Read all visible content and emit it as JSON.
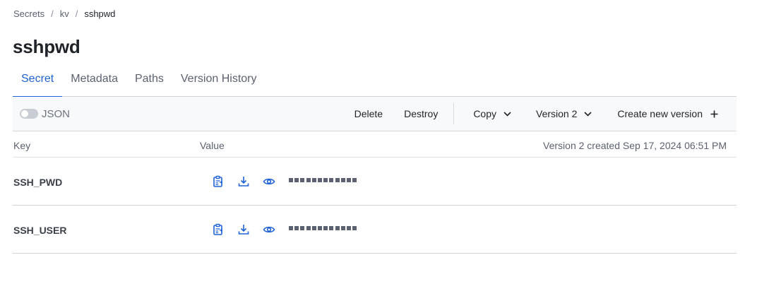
{
  "breadcrumb": {
    "items": [
      "Secrets",
      "kv",
      "sshpwd"
    ],
    "separator": "/"
  },
  "page": {
    "title": "sshpwd"
  },
  "tabs": [
    {
      "label": "Secret",
      "active": true
    },
    {
      "label": "Metadata",
      "active": false
    },
    {
      "label": "Paths",
      "active": false
    },
    {
      "label": "Version History",
      "active": false
    }
  ],
  "toolbar": {
    "json_toggle": {
      "label": "JSON",
      "on": false
    },
    "delete_label": "Delete",
    "destroy_label": "Destroy",
    "copy_label": "Copy",
    "version_label": "Version 2",
    "create_label": "Create new version"
  },
  "table": {
    "headers": {
      "key": "Key",
      "value": "Value",
      "version_info": "Version 2 created Sep 17, 2024 06:51 PM"
    },
    "rows": [
      {
        "key": "SSH_PWD",
        "masked_length": 12,
        "icons": [
          "copy-clipboard-icon",
          "download-icon",
          "eye-icon"
        ]
      },
      {
        "key": "SSH_USER",
        "masked_length": 12,
        "icons": [
          "copy-clipboard-icon",
          "download-icon",
          "eye-icon"
        ]
      }
    ]
  },
  "colors": {
    "accent": "#1f62d6",
    "text": "#1f2328",
    "muted": "#5b6170",
    "toolbar_bg": "#f8f9fb"
  }
}
